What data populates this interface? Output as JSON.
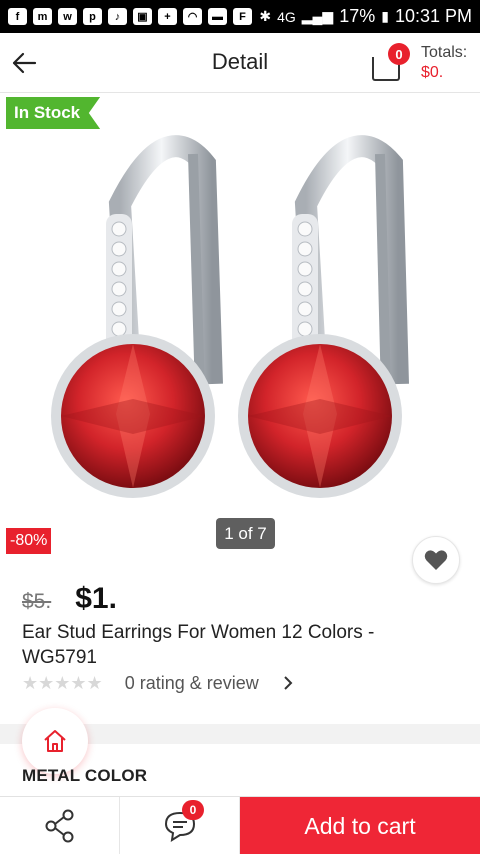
{
  "status_bar": {
    "battery": "17%",
    "time": "10:31 PM",
    "signal_label": "4G"
  },
  "header": {
    "title": "Detail",
    "cart_count": "0",
    "totals_label": "Totals:",
    "totals_value": "$0."
  },
  "hero": {
    "stock_tag": "In Stock",
    "discount": "-80%",
    "pager": "1 of 7",
    "image_icon": "earrings-image",
    "accent_color": "#e8212d",
    "stock_color": "#52b62f"
  },
  "product": {
    "old_price": "$5.",
    "new_price": "$1.",
    "name": "Ear Stud Earrings For Women 12 Colors - WG5791",
    "rating_text": "0 rating & review",
    "stars": "★★★★★"
  },
  "section": {
    "title": "METAL COLOR"
  },
  "bottom_bar": {
    "message_badge": "0",
    "add_to_cart": "Add to cart"
  }
}
